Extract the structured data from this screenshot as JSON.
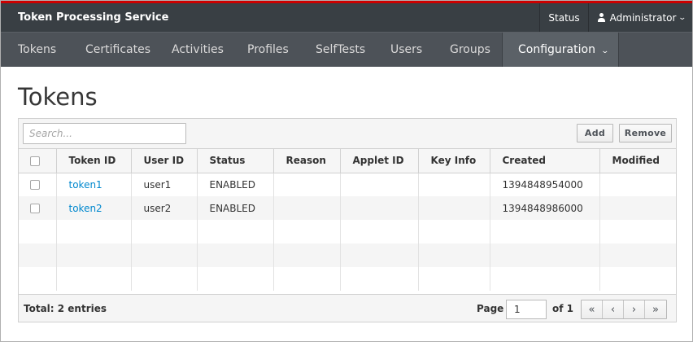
{
  "header": {
    "brand": "Token Processing Service",
    "status_link": "Status",
    "user_menu": "Administrator"
  },
  "nav": {
    "items": [
      "Tokens",
      "Certificates",
      "Activities",
      "Profiles",
      "SelfTests",
      "Users",
      "Groups",
      "Configuration"
    ],
    "active": "Configuration"
  },
  "page": {
    "title": "Tokens"
  },
  "toolbar": {
    "search_placeholder": "Search...",
    "add_label": "Add",
    "remove_label": "Remove"
  },
  "table": {
    "columns": [
      "Token ID",
      "User ID",
      "Status",
      "Reason",
      "Applet ID",
      "Key Info",
      "Created",
      "Modified"
    ],
    "rows": [
      {
        "token_id": "token1",
        "user_id": "user1",
        "status": "ENABLED",
        "reason": "",
        "applet_id": "",
        "key_info": "",
        "created": "1394848954000",
        "modified": ""
      },
      {
        "token_id": "token2",
        "user_id": "user2",
        "status": "ENABLED",
        "reason": "",
        "applet_id": "",
        "key_info": "",
        "created": "1394848986000",
        "modified": ""
      }
    ]
  },
  "footer": {
    "total": "Total: 2 entries",
    "page_label": "Page",
    "page_value": "1",
    "of_label": "of 1",
    "pager_icons": [
      "double-chevron-left-icon",
      "chevron-left-icon",
      "chevron-right-icon",
      "double-chevron-right-icon"
    ]
  },
  "colors": {
    "accent_red": "#cc0000",
    "header_bg": "#393f44",
    "nav_bg": "#4d5258",
    "link": "#0088ce"
  }
}
